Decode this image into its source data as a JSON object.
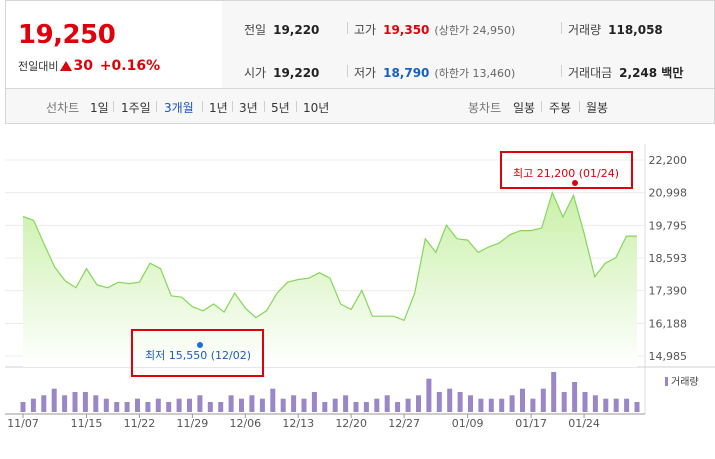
{
  "quote": {
    "price": "19,250",
    "change_label": "전일대비",
    "change_value": "30",
    "change_percent": "+0.16%",
    "stats": {
      "prev_close": {
        "label": "전일",
        "value": "19,220"
      },
      "high": {
        "label": "고가",
        "value": "19,350",
        "sub": "(상한가 24,950)"
      },
      "volume": {
        "label": "거래량",
        "value": "118,058"
      },
      "open": {
        "label": "시가",
        "value": "19,220"
      },
      "low": {
        "label": "저가",
        "value": "18,790",
        "sub": "(하한가 13,460)"
      },
      "amount": {
        "label": "거래대금",
        "value": "2,248 백만"
      }
    }
  },
  "tabs": {
    "line_title": "선차트",
    "line_items": [
      "1일",
      "1주일",
      "3개월",
      "1년",
      "3년",
      "5년",
      "10년"
    ],
    "line_active": "3개월",
    "candle_title": "봉차트",
    "candle_items": [
      "일봉",
      "주봉",
      "월봉"
    ]
  },
  "chart_data": {
    "type": "area",
    "y_ticks": [
      "22,200",
      "20,998",
      "19,795",
      "18,593",
      "17,390",
      "16,188",
      "14,985"
    ],
    "ylim": [
      14985,
      22200
    ],
    "x_ticks": [
      "11/07",
      "11/15",
      "11/22",
      "11/29",
      "12/06",
      "12/13",
      "12/20",
      "12/27",
      "01/09",
      "01/17",
      "01/24"
    ],
    "x_tick_index": [
      0,
      6,
      11,
      16,
      21,
      26,
      31,
      36,
      42,
      48,
      53
    ],
    "values": [
      20120,
      19980,
      19100,
      18250,
      17750,
      17500,
      18200,
      17600,
      17500,
      17700,
      17650,
      17700,
      18400,
      18200,
      17200,
      17150,
      16800,
      16650,
      16900,
      16600,
      17300,
      16750,
      16400,
      16650,
      17300,
      17700,
      17800,
      17850,
      18050,
      17850,
      16900,
      16700,
      17400,
      16450,
      16450,
      16450,
      16300,
      17300,
      19300,
      18800,
      19800,
      19300,
      19250,
      18800,
      19000,
      19150,
      19450,
      19600,
      19600,
      19700,
      21000,
      20100,
      20900,
      19500,
      17900,
      18400,
      18600,
      19400,
      19400
    ],
    "volume": [
      3,
      4,
      5,
      7,
      5,
      6,
      6,
      5,
      4,
      3,
      3,
      4,
      3,
      4,
      3,
      4,
      4,
      5,
      3,
      3,
      5,
      4,
      5,
      4,
      7,
      4,
      5,
      4,
      6,
      3,
      4,
      5,
      3,
      3,
      4,
      5,
      3,
      4,
      5,
      10,
      6,
      7,
      6,
      5,
      4,
      4,
      4,
      5,
      7,
      4,
      7,
      12,
      6,
      9,
      6,
      5,
      4,
      4,
      4,
      3
    ],
    "max_annotation": "최고 21,200 (01/24)",
    "min_annotation": "최저 15,550 (12/02)",
    "volume_legend": "거래량",
    "colors": {
      "line": "#86d65a",
      "fill_top": "#c9f0a8",
      "bar": "#9b86c8",
      "axis_text": "#555555",
      "dot_max": "#e0000b",
      "dot_min": "#1a6fd6",
      "highlight": "#e0000b"
    }
  }
}
